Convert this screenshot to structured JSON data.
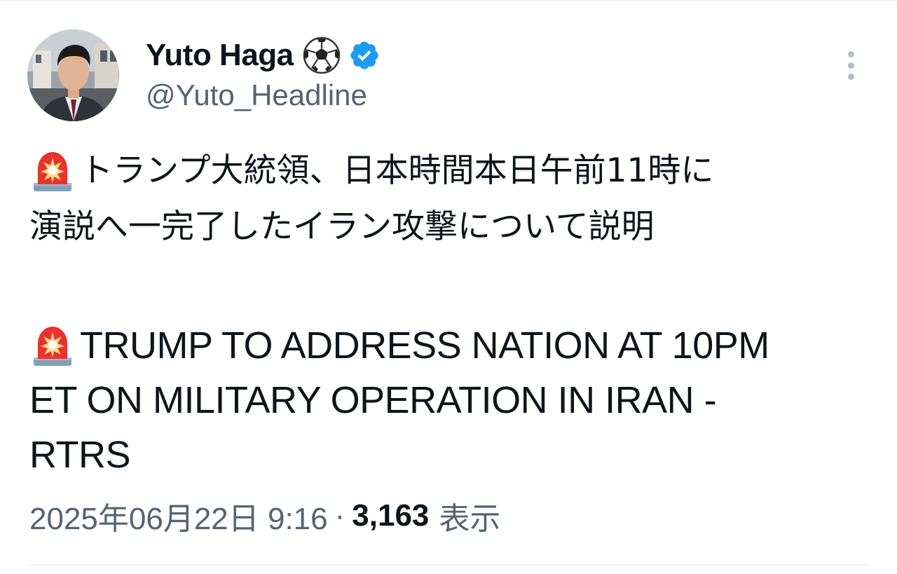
{
  "user": {
    "display_name": "Yuto Haga",
    "name_emoji_icon": "soccer-ball-icon",
    "verified_icon": "verified-badge-icon",
    "handle": "@Yuto_Headline",
    "avatar": "profile-photo-man-in-suit"
  },
  "tweet": {
    "line1": "トランプ大統領、日本時間本日午前11時に",
    "line2": "演説へ一完了したイラン攻撃について説明",
    "line3": "TRUMP TO ADDRESS NATION AT 10PM",
    "line4": "ET ON MILITARY OPERATION IN IRAN -",
    "line5": "RTRS",
    "emoji_icon": "rotating-light-siren-icon"
  },
  "meta": {
    "timestamp": "2025年06月22日 9:16",
    "separator": "·",
    "views_count": "3,163",
    "views_label": "表示"
  },
  "colors": {
    "text_primary": "#0f1419",
    "text_secondary": "#536471",
    "verified_blue": "#1d9bf0",
    "divider": "#eff3f4"
  }
}
